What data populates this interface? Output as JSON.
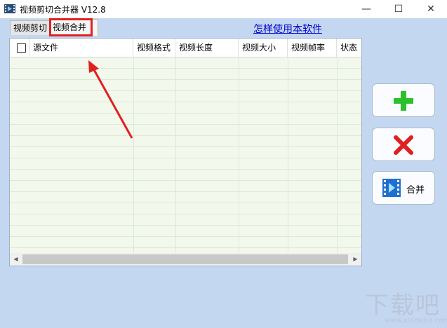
{
  "window": {
    "title": "视频剪切合并器 V12.8",
    "minimize": "—",
    "maximize": "☐",
    "close": "✕"
  },
  "tabs": [
    {
      "label": "视频剪切"
    },
    {
      "label": "视频合并"
    }
  ],
  "help_link": "怎样使用本软件",
  "table": {
    "columns": [
      "源文件",
      "视频格式",
      "视频长度",
      "视频大小",
      "视频帧率",
      "状态"
    ]
  },
  "buttons": {
    "merge_label": "合并"
  },
  "colors": {
    "add": "#2cc02c",
    "delete": "#e02020",
    "highlight": "#e02020"
  },
  "watermark": {
    "main": "下载吧",
    "sub": "www.xiazaiba.com"
  }
}
